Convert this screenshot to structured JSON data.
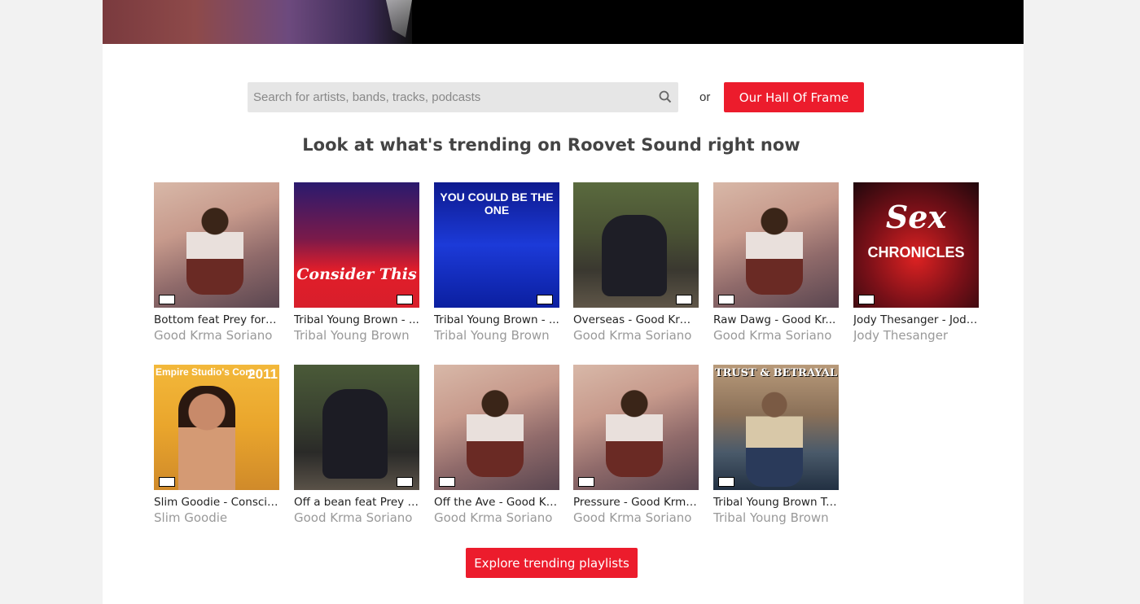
{
  "search": {
    "placeholder": "Search for artists, bands, tracks, podcasts",
    "icon": "search-icon"
  },
  "or_text": "or",
  "hall_button": "Our Hall Of Frame",
  "heading": "Look at what's trending on Roovet Sound right now",
  "tracks": [
    {
      "title": "Bottom feat Prey for C...",
      "artist": "Good Krma Soriano",
      "cover": "cartoon"
    },
    {
      "title": "Tribal Young Brown - ...",
      "artist": "Tribal Young Brown",
      "cover": "consider",
      "cover_text": "Consider This"
    },
    {
      "title": "Tribal Young Brown - ...",
      "artist": "Tribal Young Brown",
      "cover": "youcould",
      "cover_text": "YOU COULD BE THE ONE"
    },
    {
      "title": "Overseas - Good Krm...",
      "artist": "Good Krma Soriano",
      "cover": "overseas"
    },
    {
      "title": "Raw Dawg - Good Kr...",
      "artist": "Good Krma Soriano",
      "cover": "cartoon"
    },
    {
      "title": "Jody Thesanger - Jody...",
      "artist": "Jody Thesanger",
      "cover": "sex",
      "cover_text_1": "Sex",
      "cover_text_2": "CHRONICLES"
    },
    {
      "title": "Slim Goodie - Conscie...",
      "artist": "Slim Goodie",
      "cover": "empire",
      "cover_text": "Empire Studio's Corn",
      "cover_year": "2011"
    },
    {
      "title": "Off a bean feat Prey fo...",
      "artist": "Good Krma Soriano",
      "cover": "bean"
    },
    {
      "title": "Off the Ave - Good Kr...",
      "artist": "Good Krma Soriano",
      "cover": "cartoon"
    },
    {
      "title": "Pressure - Good Krma...",
      "artist": "Good Krma Soriano",
      "cover": "cartoon"
    },
    {
      "title": "Tribal Young Brown Tr...",
      "artist": "Tribal Young Brown",
      "cover": "trust",
      "cover_text": "TRUST & BETRAYAL"
    }
  ],
  "explore_button": "Explore trending playlists",
  "colors": {
    "accent": "#ec1c2c",
    "page_bg": "#f2f2f2",
    "artist_text": "#999999"
  }
}
